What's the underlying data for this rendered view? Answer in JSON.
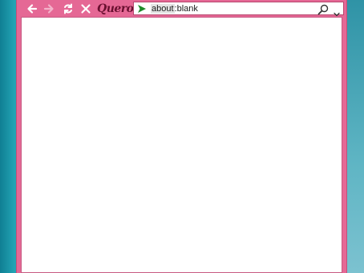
{
  "app": {
    "brand": "Quero",
    "accent_color": "#e56895",
    "desktop_color": "#1a8ea0"
  },
  "toolbar": {
    "back_icon": "arrow-left-icon",
    "forward_icon": "arrow-right-icon",
    "reload_icon": "reload-icon",
    "stop_icon": "close-icon"
  },
  "address_bar": {
    "url_scheme": "about",
    "url_rest": ":blank",
    "go_icon": "go-arrow-icon",
    "search_icon": "search-icon",
    "dropdown_icon": "chevron-down-icon"
  }
}
